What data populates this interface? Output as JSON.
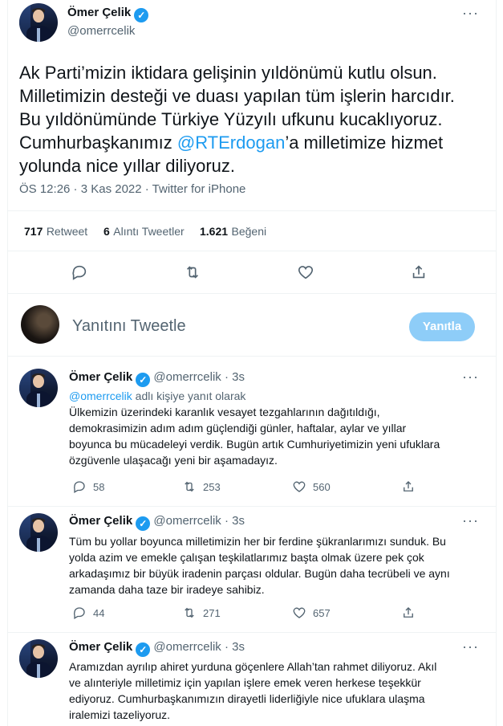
{
  "main_tweet": {
    "author_name": "Ömer Çelik",
    "author_handle": "@omerrcelik",
    "text_before_mention": "Ak Parti’mizin iktidara gelişinin yıldönümü kutlu olsun.\nMilletimizin desteği ve duası yapılan tüm işlerin harcıdır.\nBu yıldönümünde Türkiye Yüzyılı ufkunu kucaklıyoruz.\nCumhurbaşkanımız ",
    "mention": "@RTErdogan",
    "text_after_mention": "’a milletimize hizmet\nyolunda nice yıllar diliyoruz.",
    "timestamp": "ÖS 12:26 · 3 Kas 2022 · Twitter for iPhone",
    "retweets_count": "717",
    "retweets_label": "Retweet",
    "quotes_count": "6",
    "quotes_label": "Alıntı Tweetler",
    "likes_count": "1.621",
    "likes_label": "Beğeni"
  },
  "compose": {
    "placeholder": "Yanıtını Tweetle",
    "button_label": "Yanıtla"
  },
  "replies": [
    {
      "author_name": "Ömer Çelik",
      "author_handle": "@omerrcelik",
      "time": "· 3s",
      "replying_to_handle": "@omerrcelik",
      "replying_to_suffix": " adlı kişiye yanıt olarak",
      "text": "Ülkemizin üzerindeki karanlık vesayet tezgahlarının dağıtıldığı,\ndemokrasimizin adım adım güçlendiği günler, haftalar, aylar ve yıllar\nboyunca bu mücadeleyi verdik. Bugün artık Cumhuriyetimizin yeni ufuklara\nözgüvenle ulaşacağı yeni bir aşamadayız.",
      "replies": "58",
      "retweets": "253",
      "likes": "560"
    },
    {
      "author_name": "Ömer Çelik",
      "author_handle": "@omerrcelik",
      "time": "· 3s",
      "text": "Tüm bu yollar boyunca milletimizin her bir ferdine şükranlarımızı sunduk. Bu\nyolda azim ve emekle çalışan teşkilatlarımız başta olmak üzere pek çok\narkadaşımız bir büyük iradenin parçası oldular. Bugün daha tecrübeli ve aynı\nzamanda daha taze bir iradeye sahibiz.",
      "replies": "44",
      "retweets": "271",
      "likes": "657"
    },
    {
      "author_name": "Ömer Çelik",
      "author_handle": "@omerrcelik",
      "time": "· 3s",
      "text": "Aramızdan ayrılıp ahiret yurduna göçenlere Allah’tan rahmet diliyoruz. Akıl\nve alınteriyle milletimiz için yapılan işlere emek veren herkese teşekkür\nediyoruz. Cumhurbaşkanımızın dirayetli liderliğiyle nice ufuklara ulaşma\niralemizi tazeliyoruz."
    }
  ],
  "icons": {
    "verified": "verified-badge-icon",
    "more": "more-icon",
    "reply": "reply-icon",
    "retweet": "retweet-icon",
    "like": "like-icon",
    "share": "share-icon"
  },
  "colors": {
    "accent": "#1d9bf0",
    "button_disabled": "#8ecdf8",
    "secondary_text": "#536471",
    "divider": "#eff3f4"
  }
}
